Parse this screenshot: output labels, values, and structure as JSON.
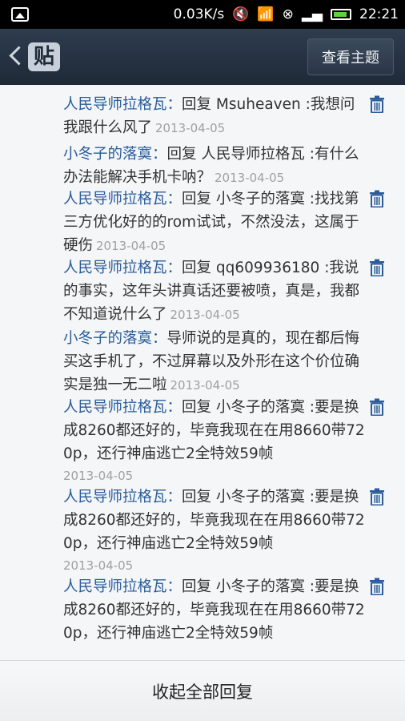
{
  "status_bar": {
    "speed": "0.03K/s",
    "time": "22:21",
    "battery_color": "#5fd13a"
  },
  "header": {
    "logo_text": "贴",
    "topic_button": "查看主题"
  },
  "replies": [
    {
      "author": "人民导师拉格瓦：",
      "body": "回复 Msuheaven :我想问我跟什么风了",
      "time": "2013-04-05",
      "deletable": true
    },
    {
      "author": "小冬子的落寞：",
      "body": "回复 人民导师拉格瓦 :有什么办法能解决手机卡呐？",
      "time": "2013-04-05",
      "deletable": false
    },
    {
      "author": "人民导师拉格瓦：",
      "body": "回复 小冬子的落寞 :找找第三方优化好的的rom试试，不然没法，这属于硬伤",
      "time": "2013-04-05",
      "deletable": true
    },
    {
      "author": "人民导师拉格瓦：",
      "body": "回复 qq609936180 :我说的事实，这年头讲真话还要被喷，真是，我都不知道说什么了",
      "time": "2013-04-05",
      "deletable": true
    },
    {
      "author": "小冬子的落寞：",
      "body": "导师说的是真的，现在都后悔买这手机了，不过屏幕以及外形在这个价位确实是独一无二啦",
      "time": "2013-04-05",
      "deletable": false
    },
    {
      "author": "人民导师拉格瓦：",
      "body": "回复 小冬子的落寞 :要是换成8260都还好的，毕竟我现在在用8660带720p，还行神庙逃亡2全特效59帧",
      "time": "2013-04-05",
      "deletable": true
    },
    {
      "author": "人民导师拉格瓦：",
      "body": "回复 小冬子的落寞 :要是换成8260都还好的，毕竟我现在在用8660带720p，还行神庙逃亡2全特效59帧",
      "time": "2013-04-05",
      "deletable": true
    },
    {
      "author": "人民导师拉格瓦：",
      "body": "回复 小冬子的落寞 :要是换成8260都还好的，毕竟我现在在用8660带720p，还行神庙逃亡2全特效59帧",
      "time": "2013-04-05",
      "deletable": true
    }
  ],
  "footer": {
    "collapse_label": "收起全部回复"
  },
  "colors": {
    "author": "#2a5c9a",
    "timestamp": "#a0a0a0",
    "trash": "#2a5c9a",
    "header_bg": "#2a3646"
  }
}
